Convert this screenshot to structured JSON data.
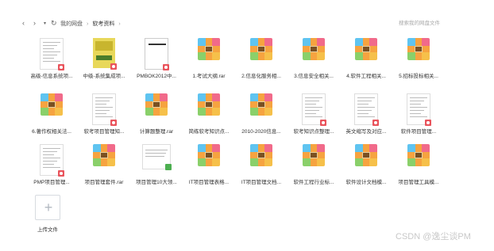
{
  "nav": {
    "back": "‹",
    "forward": "›",
    "dropdown": "▾",
    "refresh": "↻"
  },
  "breadcrumb": {
    "items": [
      "我的网盘",
      "软考资料"
    ]
  },
  "search": {
    "placeholder": "搜索我的网盘文件"
  },
  "files": [
    {
      "label": "高级-信息系统项...",
      "type": "pdf"
    },
    {
      "label": "中级-系统集成项...",
      "type": "book"
    },
    {
      "label": "PMBOK2012中...",
      "type": "pmbok"
    },
    {
      "label": "1.考试大纲.rar",
      "type": "rar"
    },
    {
      "label": "2.信息化服务相...",
      "type": "rar"
    },
    {
      "label": "3.信息安全相关...",
      "type": "rar"
    },
    {
      "label": "4.软件工程相关...",
      "type": "rar"
    },
    {
      "label": "5.招标投标相关...",
      "type": "rar"
    },
    {
      "label": "6.著作权相关法...",
      "type": "rar"
    },
    {
      "label": "软考项目管理知...",
      "type": "doc"
    },
    {
      "label": "计算题整理.rar",
      "type": "rar"
    },
    {
      "label": "简练软考知识点...",
      "type": "rar"
    },
    {
      "label": "2010-2020信息...",
      "type": "rar"
    },
    {
      "label": "软考知识点整理...",
      "type": "pdf"
    },
    {
      "label": "英文缩写及对应...",
      "type": "pdf"
    },
    {
      "label": "软件项目管理...",
      "type": "pdf"
    },
    {
      "label": "PMP项目管理...",
      "type": "pdf"
    },
    {
      "label": "项目管理套件.rar",
      "type": "rar"
    },
    {
      "label": "项目管理10大领...",
      "type": "xls"
    },
    {
      "label": "IT项目管理表格...",
      "type": "rar"
    },
    {
      "label": "IT项目管理文档...",
      "type": "rar"
    },
    {
      "label": "软件工程行业标...",
      "type": "rar"
    },
    {
      "label": "软件设计文档模...",
      "type": "rar"
    },
    {
      "label": "项目管理工具模...",
      "type": "rar"
    }
  ],
  "upload": {
    "plus": "+",
    "label": "上传文件"
  },
  "watermark": "CSDN @逸尘谈PM"
}
